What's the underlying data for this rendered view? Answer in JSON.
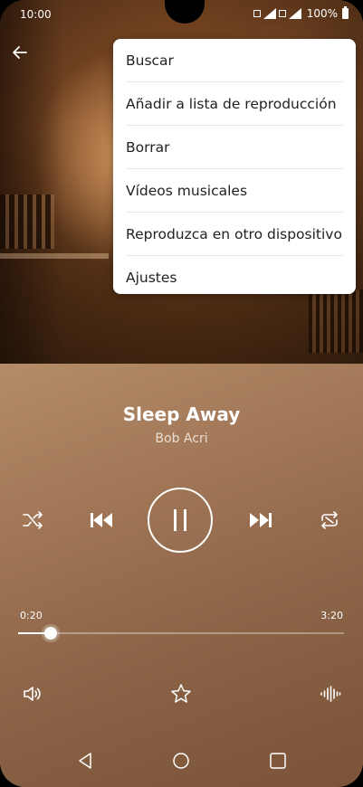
{
  "status_bar": {
    "time": "10:00",
    "battery": "100%"
  },
  "menu": {
    "items": [
      {
        "label": "Buscar"
      },
      {
        "label": "Añadir a lista de reproducción"
      },
      {
        "label": "Borrar"
      },
      {
        "label": "Vídeos musicales"
      },
      {
        "label": "Reproduzca en otro dispositivo"
      },
      {
        "label": "Ajustes"
      }
    ]
  },
  "player": {
    "title": "Sleep Away",
    "artist": "Bob Acri",
    "elapsed": "0:20",
    "duration": "3:20",
    "progress_fraction": 0.1,
    "icons": [
      "shuffle-icon",
      "previous-icon",
      "pause-icon",
      "next-icon",
      "repeat-icon",
      "volume-icon",
      "favorite-star-icon",
      "equalizer-icon"
    ]
  },
  "navbar": {
    "icons": [
      "back-triangle-icon",
      "home-circle-icon",
      "recents-square-icon"
    ]
  }
}
